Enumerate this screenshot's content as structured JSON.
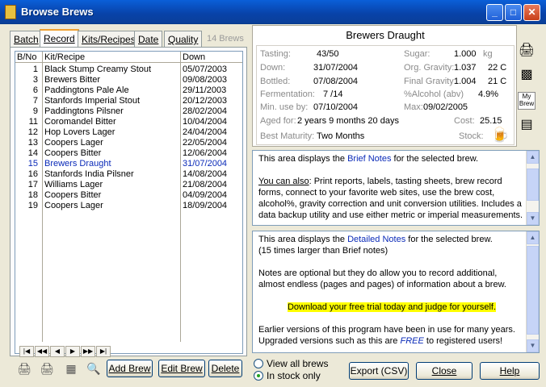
{
  "window": {
    "title": "Browse Brews"
  },
  "tabs": [
    {
      "label": "Batch"
    },
    {
      "label": "Record"
    },
    {
      "label": "Kits/Recipes"
    },
    {
      "label": "Date"
    },
    {
      "label": "Quality"
    }
  ],
  "brew_count": "14 Brews",
  "list": {
    "headers": [
      "B/No",
      "Kit/Recipe",
      "Down"
    ],
    "rows": [
      {
        "num": "1",
        "name": "Black Stump Creamy Stout",
        "down": "05/07/2003"
      },
      {
        "num": "3",
        "name": "Brewers Bitter",
        "down": "09/08/2003"
      },
      {
        "num": "6",
        "name": "Paddingtons Pale Ale",
        "down": "29/11/2003"
      },
      {
        "num": "7",
        "name": "Stanfords Imperial Stout",
        "down": "20/12/2003"
      },
      {
        "num": "9",
        "name": "Paddingtons Pilsner",
        "down": "28/02/2004"
      },
      {
        "num": "11",
        "name": "Coromandel Bitter",
        "down": "10/04/2004"
      },
      {
        "num": "12",
        "name": "Hop Lovers Lager",
        "down": "24/04/2004"
      },
      {
        "num": "13",
        "name": "Coopers Lager",
        "down": "22/05/2004"
      },
      {
        "num": "14",
        "name": "Coopers Bitter",
        "down": "12/06/2004"
      },
      {
        "num": "15",
        "name": "Brewers Draught",
        "down": "31/07/2004"
      },
      {
        "num": "16",
        "name": "Stanfords India Pilsner",
        "down": "14/08/2004"
      },
      {
        "num": "17",
        "name": "Williams Lager",
        "down": "21/08/2004"
      },
      {
        "num": "18",
        "name": "Coopers Bitter",
        "down": "04/09/2004"
      },
      {
        "num": "19",
        "name": "Coopers Lager",
        "down": "18/09/2004"
      }
    ]
  },
  "nav": [
    "|◀",
    "◀◀",
    "◀",
    "▶",
    "▶▶",
    "▶|"
  ],
  "buttons": {
    "add_brew": "Add Brew",
    "edit_brew": "Edit Brew",
    "delete": "Delete",
    "export": "Export (CSV)",
    "close": "Close",
    "help": "Help"
  },
  "info": {
    "title": "Brewers Draught",
    "tasting_label": "Tasting:",
    "tasting": "43/50",
    "sugar_label": "Sugar:",
    "sugar": "1.000",
    "sugar_unit": "kg",
    "down_label": "Down:",
    "down": "31/07/2004",
    "org_gravity_label": "Org. Gravity:",
    "org_gravity": "1.037",
    "org_temp": "22 C",
    "bottled_label": "Bottled:",
    "bottled": "07/08/2004",
    "final_gravity_label": "Final Gravity:",
    "final_gravity": "1.004",
    "final_temp": "21 C",
    "fermentation_label": "Fermentation:",
    "fermentation": "7 /14",
    "alcohol_label": "%Alcohol (abv)",
    "alcohol": "4.9%",
    "min_use_label": "Min. use by:",
    "min_use": "07/10/2004",
    "max_label": "Max:",
    "max": "09/02/2005",
    "aged_label": "Aged for:",
    "aged": "2 years 9 months 20 days",
    "cost_label": "Cost:",
    "cost": "25.15",
    "best_label": "Best Maturity:",
    "best": "Two Months",
    "stock_label": "Stock:"
  },
  "brief_notes": {
    "l1a": "This area displays the ",
    "l1b": "Brief Notes",
    "l1c": " for the selected brew.",
    "l2a": "You can also",
    "l2b": ": Print reports, labels, tasting sheets, brew record forms, connect to your favorite web sites, use the brew cost, alcohol%, gravity correction and unit conversion utilities. Includes a data backup utility and use either metric or imperial measurements."
  },
  "detailed_notes": {
    "l1a": "This area displays the ",
    "l1b": "Detailed Notes",
    "l1c": " for the selected brew.",
    "l1d": "(15 times larger than Brief notes)",
    "l2": "Notes are optional but they do allow you to record additional, almost endless (pages and pages) of information about a brew.",
    "l3": "Download your free trial today and judge for yourself.",
    "l4": "Earlier versions of this program have been in use for many years.",
    "l5a": "Upgraded versions such as this are ",
    "l5b": "FREE",
    "l5c": " to registered users!"
  },
  "radios": {
    "view_all": "View all brews",
    "in_stock": "In stock only"
  },
  "side_icons": {
    "my_brew": "My Brew"
  }
}
